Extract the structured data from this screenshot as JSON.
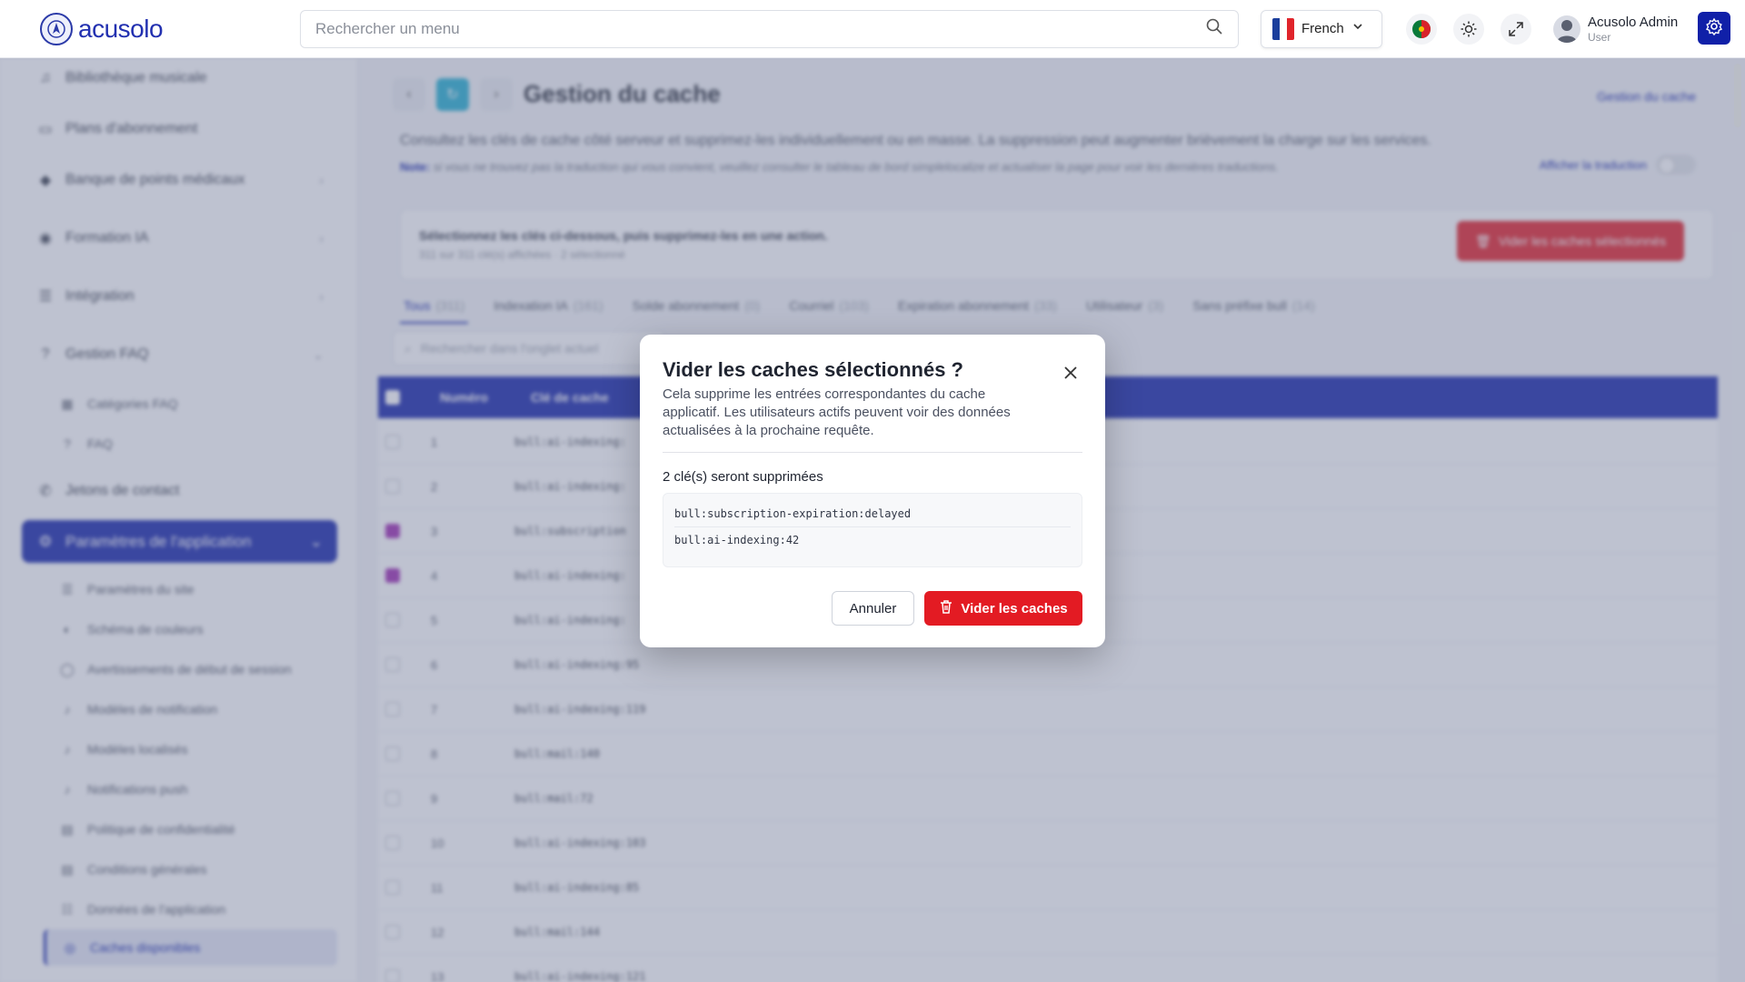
{
  "brand": {
    "name": "acusolo"
  },
  "header": {
    "search_placeholder": "Rechercher un menu",
    "language": "French",
    "user_name": "Acusolo Admin",
    "user_role": "User"
  },
  "sidebar": {
    "items": [
      {
        "label": "Bibliothèque musicale",
        "icon": "music-icon"
      },
      {
        "label": "Plans d'abonnement",
        "icon": "card-icon"
      },
      {
        "label": "Banque de points médicaux",
        "icon": "pin-icon"
      },
      {
        "label": "Formation IA",
        "icon": "ai-icon"
      },
      {
        "label": "Intégration",
        "icon": "sliders-icon"
      },
      {
        "label": "Gestion FAQ",
        "icon": "help-icon"
      },
      {
        "label": "Jetons de contact",
        "icon": "phone-icon"
      }
    ],
    "faq_children": [
      {
        "label": "Catégories FAQ"
      },
      {
        "label": "FAQ"
      }
    ],
    "active_group": "Paramètres de l'application",
    "settings_children": [
      {
        "label": "Paramètres du site"
      },
      {
        "label": "Schéma de couleurs"
      },
      {
        "label": "Avertissements de début de session"
      },
      {
        "label": "Modèles de notification"
      },
      {
        "label": "Modèles localisés"
      },
      {
        "label": "Notifications push"
      },
      {
        "label": "Politique de confidentialité"
      },
      {
        "label": "Conditions générales"
      },
      {
        "label": "Données de l'application"
      }
    ],
    "current": "Caches disponibles"
  },
  "page": {
    "title": "Gestion du cache",
    "breadcrumb": "Gestion du cache",
    "description": "Consultez les clés de cache côté serveur et supprimez-les individuellement ou en masse. La suppression peut augmenter brièvement la charge sur les services.",
    "note_label": "Note:",
    "note_text": "si vous ne trouvez pas la traduction qui vous convient, veuillez consulter le tableau de bord simplelocalize et actualiser la page pour voir les dernières traductions.",
    "translate_label": "Afficher la traduction",
    "selection_title": "Sélectionnez les clés ci-dessous, puis supprimez-les en une action.",
    "selection_sub": "311 sur 311 clé(s) affichées · 2 sélectionné",
    "clear_selected": "Vider les caches sélectionnés",
    "tab_search_placeholder": "Rechercher dans l'onglet actuel",
    "tabs": [
      {
        "label": "Tous",
        "count": "(311)"
      },
      {
        "label": "Indexation IA",
        "count": "(161)"
      },
      {
        "label": "Solde abonnement",
        "count": "(0)"
      },
      {
        "label": "Courriel",
        "count": "(103)"
      },
      {
        "label": "Expiration abonnement",
        "count": "(33)"
      },
      {
        "label": "Utilisateur",
        "count": "(3)"
      },
      {
        "label": "Sans préfixe bull",
        "count": "(14)"
      }
    ],
    "table": {
      "headers": [
        "Numéro",
        "Clé de cache"
      ],
      "rows": [
        {
          "num": "1",
          "key": "bull:ai-indexing:",
          "checked": false
        },
        {
          "num": "2",
          "key": "bull:ai-indexing:",
          "checked": false
        },
        {
          "num": "3",
          "key": "bull:subscription",
          "checked": true
        },
        {
          "num": "4",
          "key": "bull:ai-indexing:",
          "checked": true
        },
        {
          "num": "5",
          "key": "bull:ai-indexing:",
          "checked": false
        },
        {
          "num": "6",
          "key": "bull:ai-indexing:95",
          "checked": false
        },
        {
          "num": "7",
          "key": "bull:ai-indexing:119",
          "checked": false
        },
        {
          "num": "8",
          "key": "bull:mail:140",
          "checked": false
        },
        {
          "num": "9",
          "key": "bull:mail:72",
          "checked": false
        },
        {
          "num": "10",
          "key": "bull:ai-indexing:103",
          "checked": false
        },
        {
          "num": "11",
          "key": "bull:ai-indexing:85",
          "checked": false
        },
        {
          "num": "12",
          "key": "bull:mail:144",
          "checked": false
        },
        {
          "num": "13",
          "key": "bull:ai-indexing:121",
          "checked": false
        }
      ]
    }
  },
  "modal": {
    "title": "Vider les caches sélectionnés ?",
    "description": "Cela supprime les entrées correspondantes du cache applicatif. Les utilisateurs actifs peuvent voir des données actualisées à la prochaine requête.",
    "count_text": "2 clé(s) seront supprimées",
    "keys": [
      "bull:subscription-expiration:delayed",
      "bull:ai-indexing:42"
    ],
    "cancel_label": "Annuler",
    "confirm_label": "Vider les caches"
  },
  "colors": {
    "primary": "#1020a8",
    "danger": "#e31b23",
    "checkbox": "#9c27b0"
  }
}
